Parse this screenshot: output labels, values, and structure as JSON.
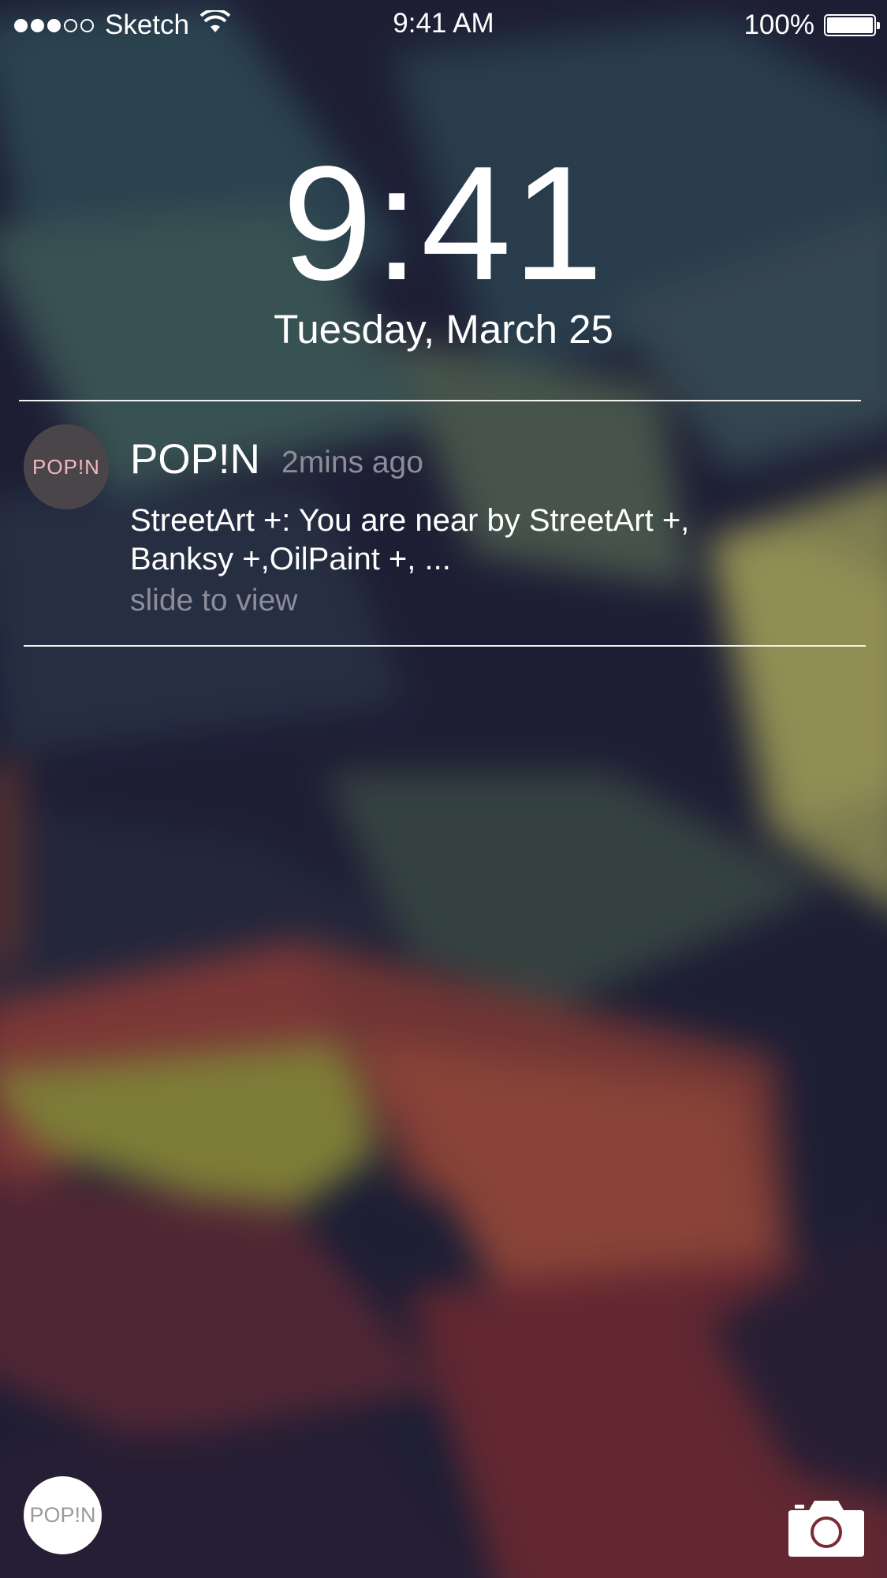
{
  "status_bar": {
    "signal_dots_filled": 3,
    "signal_dots_total": 5,
    "carrier": "Sketch",
    "wifi_icon": "wifi-icon",
    "time": "9:41 AM",
    "battery_percent": "100%",
    "battery_level": 1.0
  },
  "lock_screen": {
    "clock": "9:41",
    "date": "Tuesday, March 25"
  },
  "notification": {
    "app_icon_text": "POP!N",
    "app_name": "POP!N",
    "time_ago": "2mins ago",
    "message_line1": "StreetArt +: You are near by StreetArt +,",
    "message_line2": "Banksy +,OilPaint +, ...",
    "hint": "slide to view"
  },
  "bottom": {
    "app_button_text": "POP!N",
    "camera_icon": "camera-icon"
  },
  "colors": {
    "background": "#1e1f36",
    "secondary_text": "#8d8d9a",
    "app_icon_bg": "#4a4549",
    "app_icon_text": "#f2b7be"
  }
}
